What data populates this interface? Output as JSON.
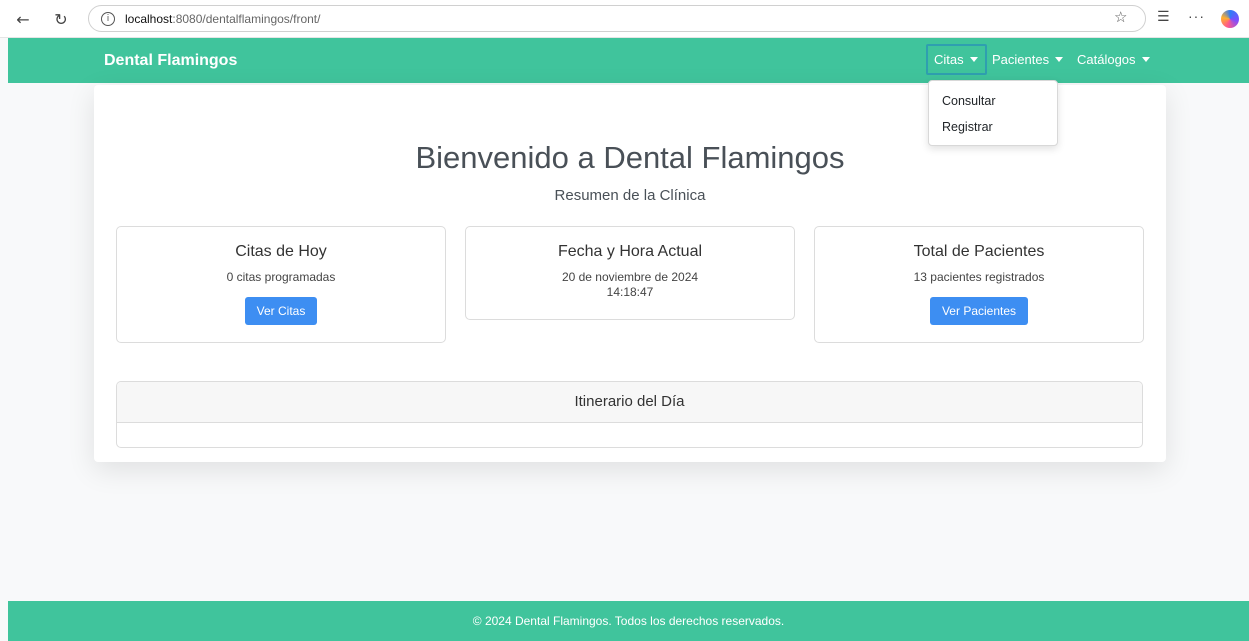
{
  "browser": {
    "back_glyph": "←",
    "reload_glyph": "↻",
    "info_glyph": "i",
    "url_host": "localhost",
    "url_rest": ":8080/dentalflamingos/front/",
    "star_glyph": "☆",
    "favorites_glyph": "☰",
    "more_glyph": "···",
    "icons": [
      "back-arrow-icon",
      "reload-icon",
      "info-icon",
      "star-icon",
      "favorites-icon",
      "more-icon",
      "copilot-icon"
    ]
  },
  "navbar": {
    "brand": "Dental Flamingos",
    "items": [
      {
        "label": "Citas"
      },
      {
        "label": "Pacientes"
      },
      {
        "label": "Catálogos"
      }
    ],
    "dropdown": {
      "items": [
        {
          "label": "Consultar"
        },
        {
          "label": "Registrar"
        }
      ]
    },
    "color": "#40c49c"
  },
  "main": {
    "title": "Bienvenido a Dental Flamingos",
    "subtitle": "Resumen de la Clínica",
    "cards": [
      {
        "title": "Citas de Hoy",
        "text": "0 citas programadas",
        "button": "Ver Citas"
      },
      {
        "title": "Fecha y Hora Actual",
        "date": "20 de noviembre de 2024",
        "time": "14:18:47"
      },
      {
        "title": "Total de Pacientes",
        "text": "13 pacientes registrados",
        "button": "Ver Pacientes"
      }
    ],
    "itinerary_title": "Itinerario del Día",
    "button_color": "#3d8ef2"
  },
  "footer": {
    "text": "© 2024 Dental Flamingos. Todos los derechos reservados."
  }
}
